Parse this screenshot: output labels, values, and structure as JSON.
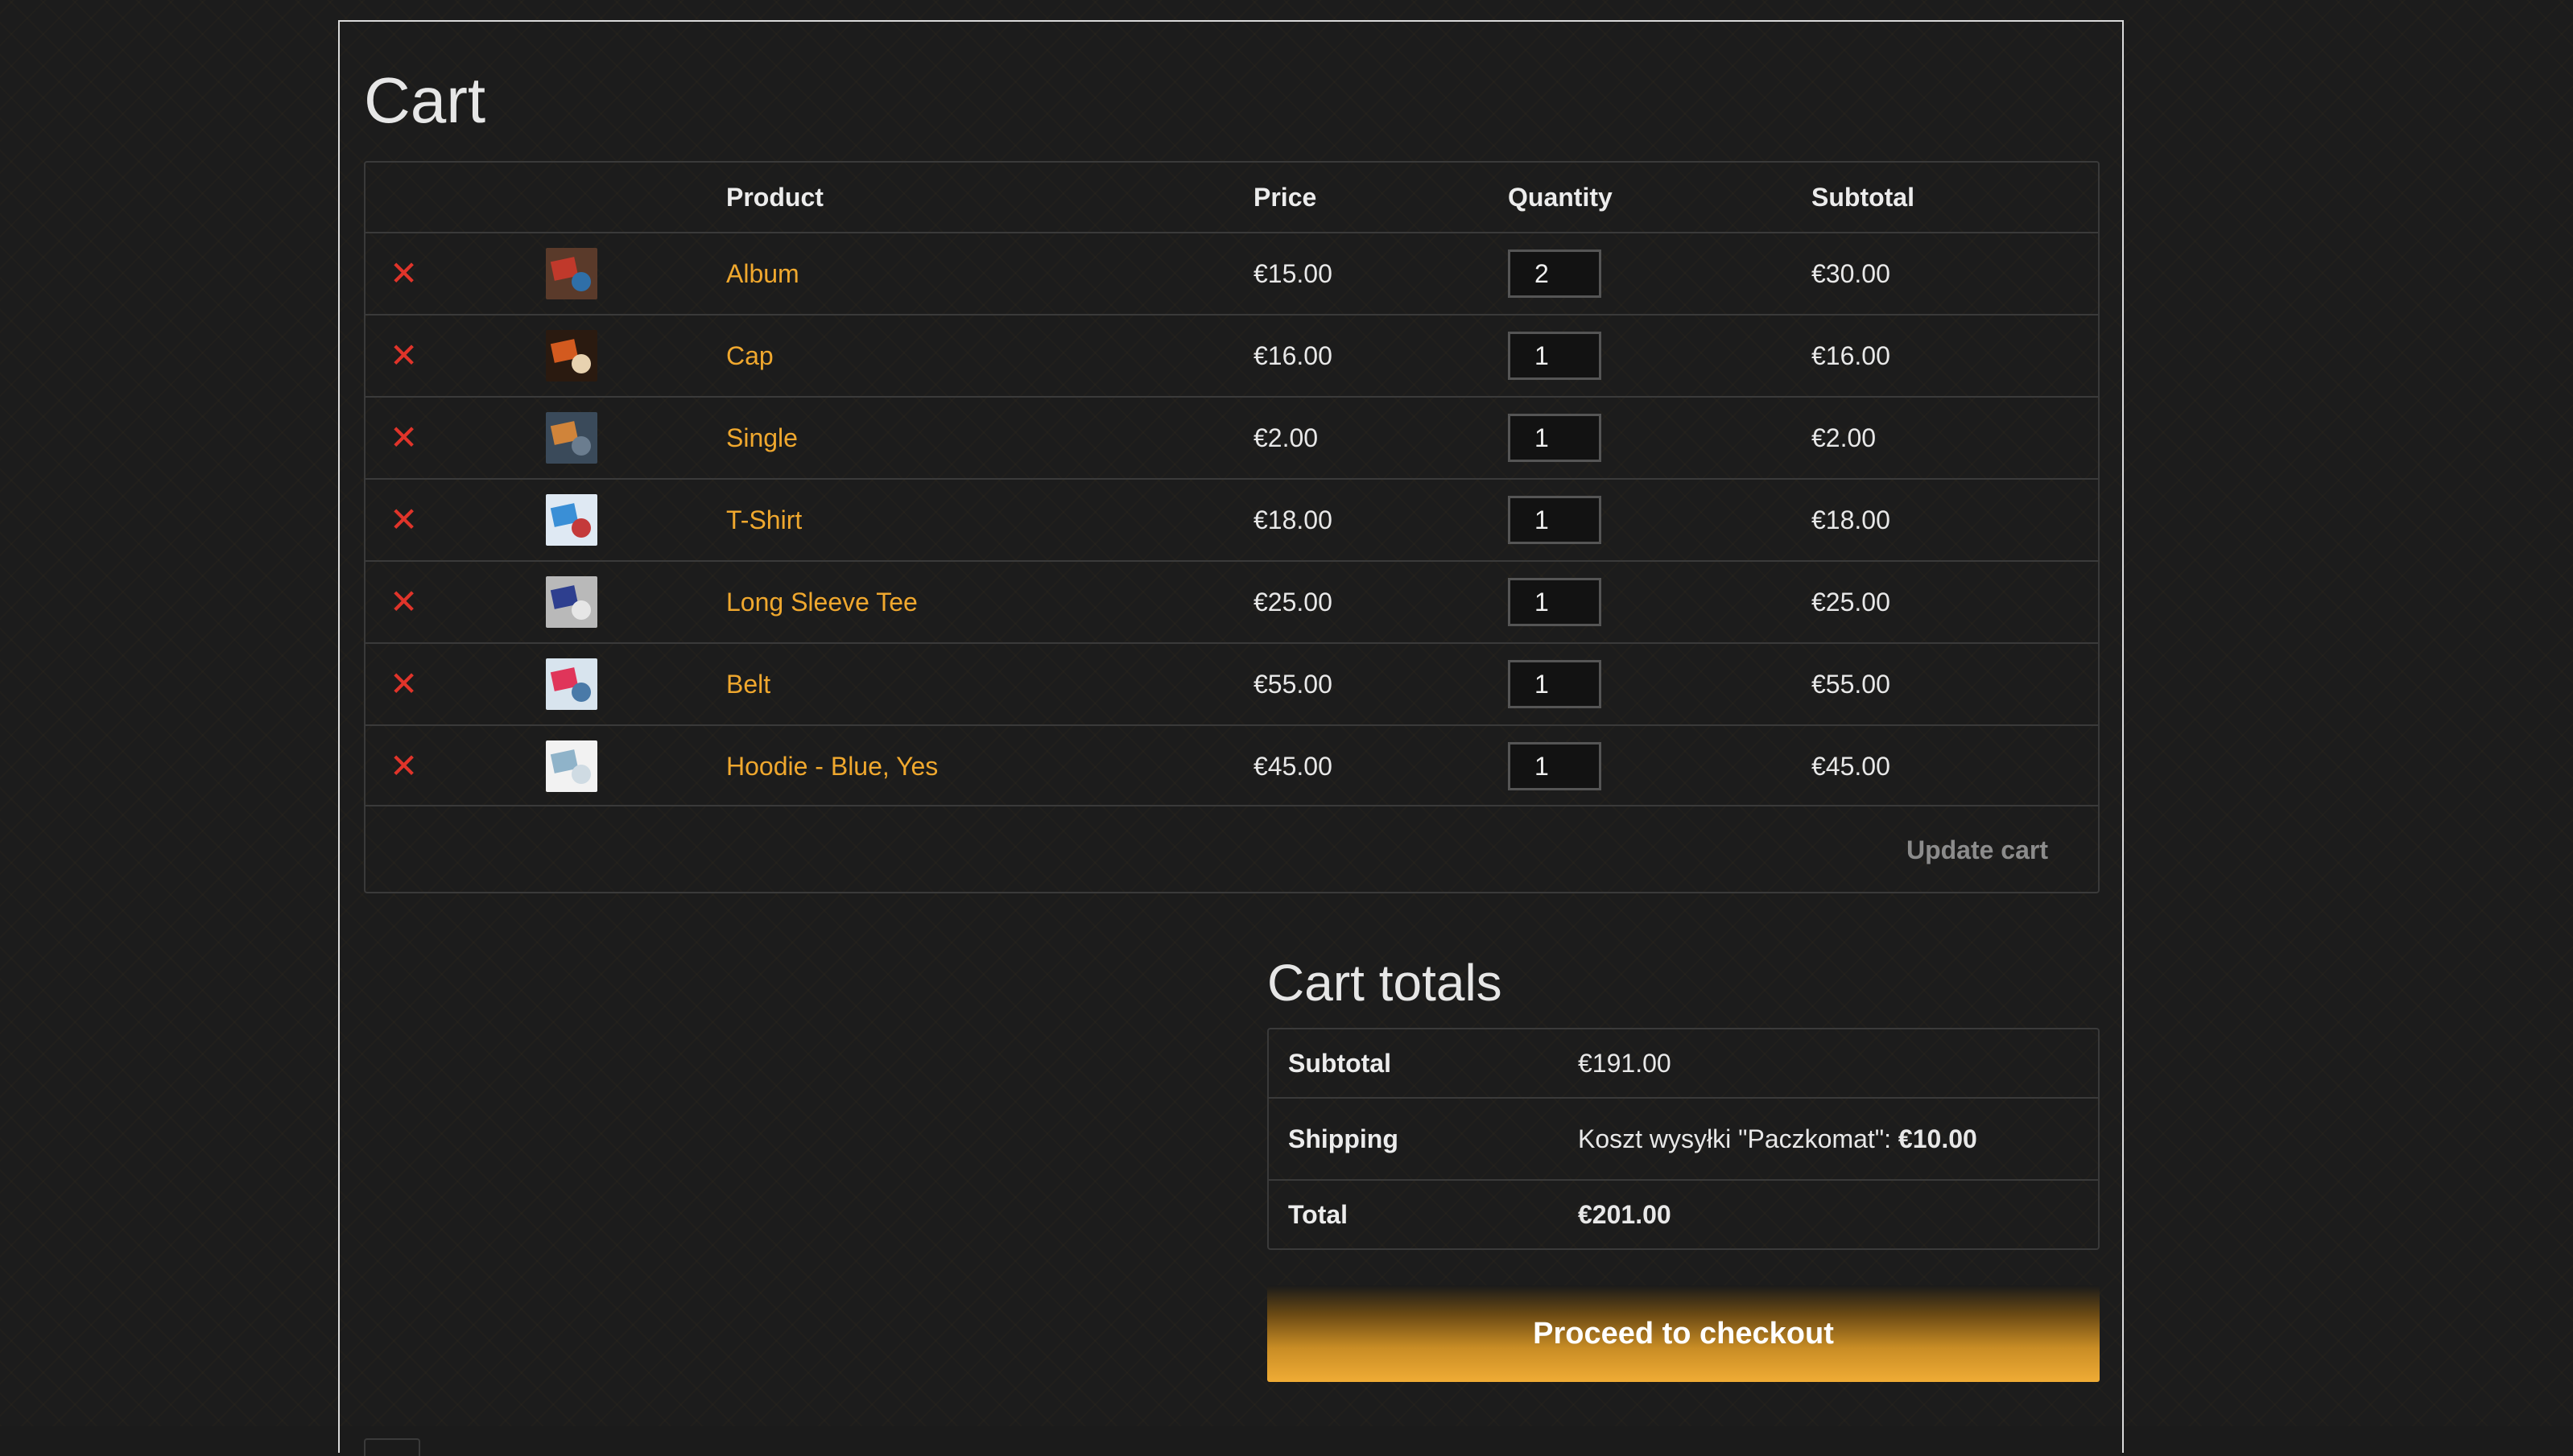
{
  "page": {
    "title": "Cart"
  },
  "cart": {
    "headers": {
      "product": "Product",
      "price": "Price",
      "quantity": "Quantity",
      "subtotal": "Subtotal"
    },
    "items": [
      {
        "name": "Album",
        "price": "€15.00",
        "quantity": "2",
        "subtotal": "€30.00",
        "thumb_colors": [
          "#5a3a2a",
          "#c0392b",
          "#2f6fa8"
        ]
      },
      {
        "name": "Cap",
        "price": "€16.00",
        "quantity": "1",
        "subtotal": "€16.00",
        "thumb_colors": [
          "#2a1a10",
          "#d35a1f",
          "#e8d2b0"
        ]
      },
      {
        "name": "Single",
        "price": "€2.00",
        "quantity": "1",
        "subtotal": "€2.00",
        "thumb_colors": [
          "#3a4a5a",
          "#d0843a",
          "#6b7d8f"
        ]
      },
      {
        "name": "T-Shirt",
        "price": "€18.00",
        "quantity": "1",
        "subtotal": "€18.00",
        "thumb_colors": [
          "#dfe9f3",
          "#3a8fd6",
          "#c43a3a"
        ]
      },
      {
        "name": "Long Sleeve Tee",
        "price": "€25.00",
        "quantity": "1",
        "subtotal": "€25.00",
        "thumb_colors": [
          "#b9b9b9",
          "#2e3f8f",
          "#e6e6e6"
        ]
      },
      {
        "name": "Belt",
        "price": "€55.00",
        "quantity": "1",
        "subtotal": "€55.00",
        "thumb_colors": [
          "#d8e4ee",
          "#e0355a",
          "#4a7aa8"
        ]
      },
      {
        "name": "Hoodie - Blue, Yes",
        "price": "€45.00",
        "quantity": "1",
        "subtotal": "€45.00",
        "thumb_colors": [
          "#f2f2f2",
          "#8fb3c9",
          "#cfdbe3"
        ]
      }
    ],
    "update_label": "Update cart",
    "remove_symbol": "✕"
  },
  "totals": {
    "title": "Cart totals",
    "subtotal_label": "Subtotal",
    "subtotal_value": "€191.00",
    "shipping_label": "Shipping",
    "shipping_text": "Koszt wysyłki \"Paczkomat\": ",
    "shipping_value": "€10.00",
    "total_label": "Total",
    "total_value": "€201.00",
    "checkout_label": "Proceed to checkout"
  },
  "colors": {
    "accent": "#f0a82e",
    "remove": "#e0342a",
    "background": "#1c1c1c"
  }
}
